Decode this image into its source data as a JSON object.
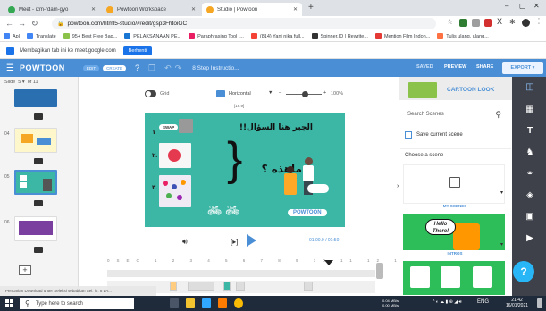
{
  "browser": {
    "tabs": [
      {
        "label": "Meet - izm-rdam-gyo",
        "color": "#34a853"
      },
      {
        "label": "Powtoon Workspace",
        "color": "#f5a623"
      },
      {
        "label": "Studio | Powtoon",
        "color": "#f5a623"
      }
    ],
    "url": "powtoon.com/html5-studio/#/edit/gsp3FhtoiGC",
    "bookmarks": [
      "Apl",
      "Translate",
      "95+ Best Free Bag...",
      "PELAKSANAAN PE...",
      "Paraphrasing Tool |...",
      "(814) Yani nika full...",
      "Spinner.ID | Rewrite...",
      "Mention Film Indon...",
      "Tulis ulang, ulang..."
    ],
    "window_controls": {
      "minimize": "–",
      "maximize": "▢",
      "close": "✕"
    }
  },
  "meet_bar": {
    "text": "Membagikan tab ini ke meet.google.com",
    "stop_label": "Berhenti"
  },
  "powtoon": {
    "logo": "POWTOON",
    "edit_pill": "EDIT",
    "create_pill": "CREATE",
    "title": "8 Step Instructio...",
    "saved": "SAVED",
    "preview": "PREVIEW",
    "share": "SHARE",
    "export": "EXPORT"
  },
  "left": {
    "slide_label": "Slide",
    "slide_current": "5",
    "slide_of": "of 11",
    "slide_numbers": [
      "04",
      "05",
      "06"
    ]
  },
  "canvas": {
    "grid_label": "Grid",
    "orientation": "Horizontal",
    "zoom": "100%",
    "aspect": "[16:9]",
    "arabic_title": "الجبر هنا السؤال!!",
    "arabic_question": "ماهذه ؟",
    "digits": [
      "١",
      "٢.",
      "٣."
    ],
    "swap_label": "SWAP",
    "time": "01:00.0 / 01:50",
    "bracket_label": "[▸]",
    "ruler": "0SEC 1 2 3 4 5 6 7 8 9 10 11 12 13 14 15",
    "logo": "POWTOON"
  },
  "right": {
    "look_label": "CARTOON LOOK",
    "search_placeholder": "Search Scenes",
    "save_scene": "Save current scene",
    "choose_scene": "Choose a scene",
    "my_scenes": "MY SCENES",
    "hello_text": "Hello There!",
    "intros": "INTROS"
  },
  "rail_icons": [
    "layers-icon",
    "pattern-icon",
    "text-icon",
    "character-icon",
    "props-icon",
    "shapes-icon",
    "frame-icon",
    "media-icon"
  ],
  "download_banner": "Pencarian Download unter Seleksi sebabkan Sel. lo. 8 LA...",
  "taskbar": {
    "search_placeholder": "Type here to search",
    "tray_text": "ENG",
    "time": "21:42",
    "date": "16/01/2021",
    "network": "0.04 MB/s\n0.00 MB/s"
  }
}
